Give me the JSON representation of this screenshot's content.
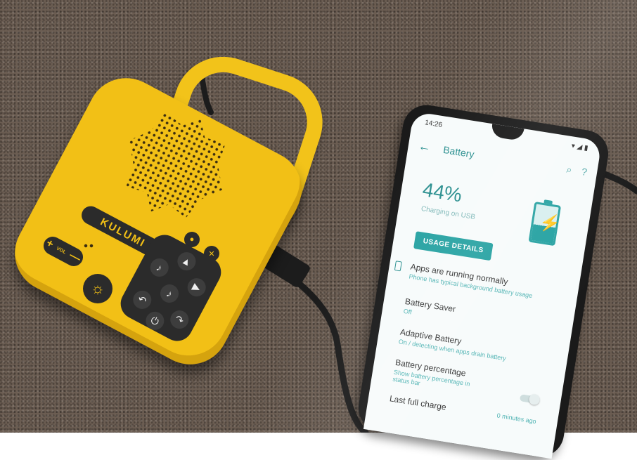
{
  "speaker": {
    "brand": "KULUMI",
    "vol_plus": "+",
    "vol_label": "VOL",
    "vol_minus": "—"
  },
  "phone": {
    "status": {
      "time": "14:26"
    },
    "app_bar": {
      "title": "Battery"
    },
    "battery": {
      "percent_text": "44%",
      "level": 44,
      "charging_text": "Charging on USB"
    },
    "usage_button": "USAGE DETAILS",
    "items": [
      {
        "title": "Apps are running normally",
        "subtitle": "Phone has typical background battery usage"
      },
      {
        "title": "Battery Saver",
        "subtitle": "Off"
      },
      {
        "title": "Adaptive Battery",
        "subtitle": "On / detecting when apps drain battery"
      },
      {
        "title": "Battery percentage",
        "subtitle": "Show battery percentage in status bar"
      },
      {
        "title": "Last full charge",
        "subtitle": "",
        "right": "0 minutes ago"
      }
    ]
  },
  "colors": {
    "speaker_yellow": "#f2c016",
    "speaker_dark": "#2b2b2b",
    "phone_accent": "#26a2a2",
    "carpet": "#6b5d52"
  }
}
